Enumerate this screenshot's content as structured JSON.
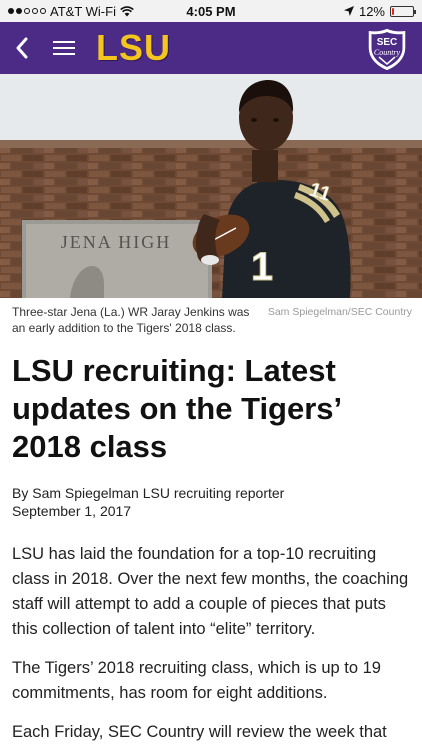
{
  "status_bar": {
    "carrier": "AT&T Wi-Fi",
    "time": "4:05 PM",
    "battery": "12%",
    "battery_level": 0.12,
    "signal_filled": 2,
    "signal_total": 5
  },
  "nav": {
    "logo_text": "LSU",
    "badge_top": "SEC",
    "badge_bottom": "Country",
    "brand_color": "#4b2b86",
    "accent_color": "#f5c51f"
  },
  "hero": {
    "sign_text": "JENA HIGH",
    "jersey_number": "11"
  },
  "article": {
    "caption": "Three-star Jena (La.) WR Jaray Jenkins was an early addition to the Tigers' 2018 class.",
    "credit": "Sam Spiegelman/SEC Country",
    "headline": "LSU recruiting: Latest updates on the Tigers’ 2018 class",
    "byline": "By Sam Spiegelman LSU recruiting reporter",
    "date": "September 1, 2017",
    "paragraphs": [
      "LSU has laid the foundation for a top-10 recruiting class in 2018. Over the next few months, the coaching staff will attempt to add a couple of pieces that puts this collection of talent into “elite” territory.",
      "The Tigers’ 2018 recruiting class, which is up to 19 commitments, has room for eight additions.",
      "Each Friday, SEC Country will review the week that"
    ]
  }
}
